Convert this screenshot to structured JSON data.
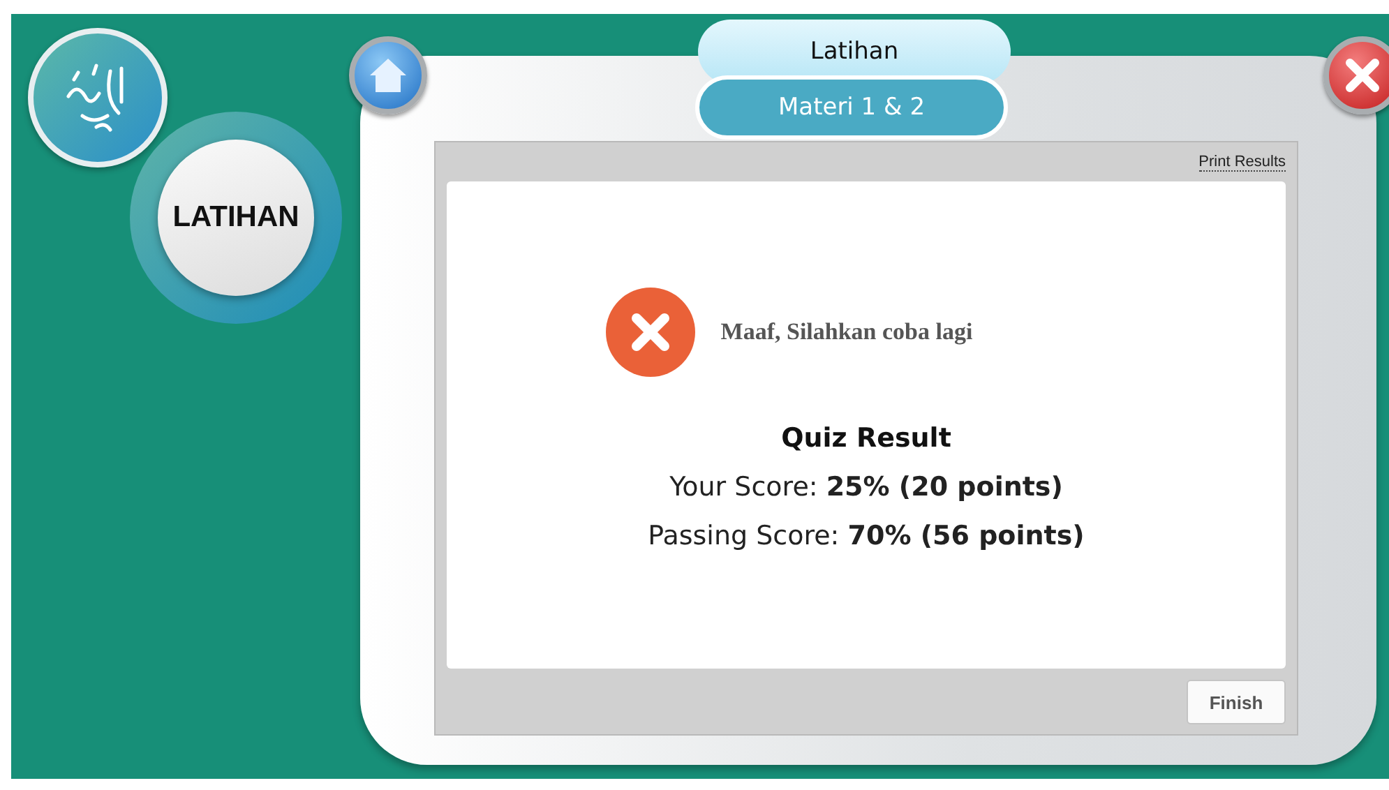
{
  "section_badge": "LATIHAN",
  "header": {
    "title": "Latihan",
    "subtitle": "Materi 1 & 2"
  },
  "print_link": "Print Results",
  "result": {
    "kind": "fail",
    "message": "Maaf, Silahkan coba lagi",
    "heading": "Quiz Result",
    "lines": [
      "Your Score: **25% (20 points)**",
      "Passing Score: **70% (56 points)**"
    ]
  },
  "finish_button": "Finish"
}
